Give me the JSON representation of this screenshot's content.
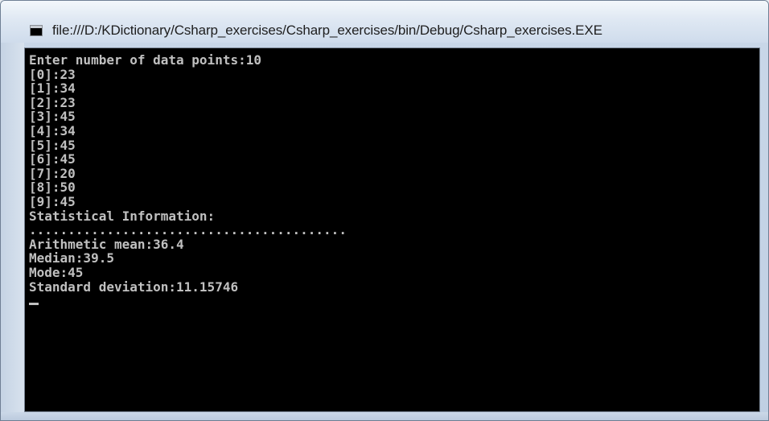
{
  "window": {
    "title": "file:///D:/KDictionary/Csharp_exercises/Csharp_exercises/bin/Debug/Csharp_exercises.EXE",
    "icon": "console-app-icon"
  },
  "console": {
    "background_color": "#000000",
    "text_color": "#c0c0c0",
    "lines": [
      "Enter number of data points:10",
      "[0]:23",
      "[1]:34",
      "[2]:23",
      "[3]:45",
      "[4]:34",
      "[5]:45",
      "[6]:45",
      "[7]:20",
      "[8]:50",
      "[9]:45",
      "Statistical Information:",
      ".........................................",
      "Arithmetic mean:36.4",
      "Median:39.5",
      "Mode:45",
      "Standard deviation:11.15746"
    ]
  }
}
